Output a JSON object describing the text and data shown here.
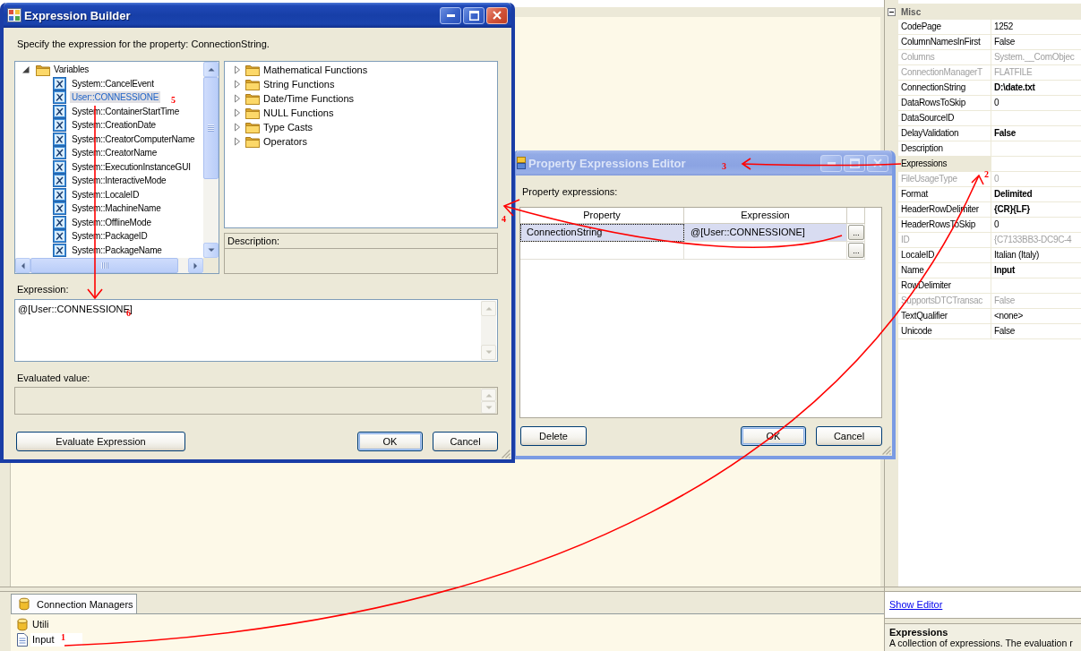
{
  "expression_builder": {
    "title": "Expression Builder",
    "active": true,
    "instruction": "Specify the expression for the property: ConnectionString.",
    "variables": {
      "label": "Variables",
      "expanded": true,
      "selected": false,
      "children": [
        {
          "label": "System::CancelEvent",
          "selected": false
        },
        {
          "label": "User::CONNESSIONE",
          "selected": true
        },
        {
          "label": "System::ContainerStartTime",
          "selected": false
        },
        {
          "label": "System::CreationDate",
          "selected": false
        },
        {
          "label": "System::CreatorComputerName",
          "selected": false
        },
        {
          "label": "System::CreatorName",
          "selected": false
        },
        {
          "label": "System::ExecutionInstanceGUI",
          "selected": false
        },
        {
          "label": "System::InteractiveMode",
          "selected": false
        },
        {
          "label": "System::LocaleID",
          "selected": false
        },
        {
          "label": "System::MachineName",
          "selected": false
        },
        {
          "label": "System::OfflineMode",
          "selected": false
        },
        {
          "label": "System::PackageID",
          "selected": false
        },
        {
          "label": "System::PackageName",
          "selected": false
        }
      ]
    },
    "functions": [
      {
        "label": "Mathematical Functions",
        "expanded": false,
        "selected": false
      },
      {
        "label": "String Functions",
        "expanded": false,
        "selected": false
      },
      {
        "label": "Date/Time Functions",
        "expanded": false,
        "selected": false
      },
      {
        "label": "NULL Functions",
        "expanded": false,
        "selected": false
      },
      {
        "label": "Type Casts",
        "expanded": false,
        "selected": false
      },
      {
        "label": "Operators",
        "expanded": false,
        "selected": false
      }
    ],
    "description_label": "Description:",
    "expression_label": "Expression:",
    "expression": "@[User::CONNESSIONE]",
    "evaluated_label": "Evaluated value:",
    "buttons": [
      {
        "label": "Evaluate Expression",
        "default": false
      },
      {
        "label": "OK",
        "default": true
      },
      {
        "label": "Cancel",
        "default": false
      }
    ]
  },
  "property_expressions_editor": {
    "title": "Property Expressions Editor",
    "active": false,
    "label": "Property expressions:",
    "columns": [
      "Property",
      "Expression"
    ],
    "rows": [
      {
        "property": "ConnectionString",
        "expression": "@[User::CONNESSIONE]",
        "button": "...",
        "selected": true
      },
      {
        "button": "...",
        "selected": false
      }
    ],
    "buttons": [
      {
        "label": "Delete",
        "default": false
      },
      {
        "label": "OK",
        "default": true
      },
      {
        "label": "Cancel",
        "default": false
      }
    ]
  },
  "properties": {
    "category": "Misc",
    "expanded": true,
    "rows": [
      {
        "name": "CodePage",
        "value": {
          "text": "1252",
          "modified": false
        },
        "disabled": false,
        "selected": false
      },
      {
        "name": "ColumnNamesInFirst",
        "value": {
          "text": "False",
          "modified": false
        },
        "disabled": false,
        "selected": false
      },
      {
        "name": "Columns",
        "value": {
          "text": "System.__ComObjec",
          "modified": false
        },
        "disabled": true,
        "selected": false
      },
      {
        "name": "ConnectionManagerT",
        "value": {
          "text": "FLATFILE",
          "modified": false
        },
        "disabled": true,
        "selected": false
      },
      {
        "name": "ConnectionString",
        "value": {
          "text": "D:\\date.txt",
          "modified": true
        },
        "disabled": false,
        "selected": false
      },
      {
        "name": "DataRowsToSkip",
        "value": {
          "text": "0",
          "modified": false
        },
        "disabled": false,
        "selected": false
      },
      {
        "name": "DataSourceID",
        "disabled": false,
        "selected": false
      },
      {
        "name": "DelayValidation",
        "value": {
          "text": "False",
          "modified": true
        },
        "disabled": false,
        "selected": false
      },
      {
        "name": "Description",
        "disabled": false,
        "selected": false
      },
      {
        "name": "Expressions",
        "disabled": false,
        "selected": true
      },
      {
        "name": "FileUsageType",
        "value": {
          "text": "0",
          "modified": false
        },
        "disabled": true,
        "selected": false
      },
      {
        "name": "Format",
        "value": {
          "text": "Delimited",
          "modified": true
        },
        "disabled": false,
        "selected": false
      },
      {
        "name": "HeaderRowDelimiter",
        "value": {
          "text": "{CR}{LF}",
          "modified": true
        },
        "disabled": false,
        "selected": false
      },
      {
        "name": "HeaderRowsToSkip",
        "value": {
          "text": "0",
          "modified": false
        },
        "disabled": false,
        "selected": false
      },
      {
        "name": "ID",
        "value": {
          "text": "{C7133BB3-DC9C-4",
          "modified": false
        },
        "disabled": true,
        "selected": false
      },
      {
        "name": "LocaleID",
        "value": {
          "text": "Italian (Italy)",
          "modified": false
        },
        "disabled": false,
        "selected": false
      },
      {
        "name": "Name",
        "value": {
          "text": "Input",
          "modified": true
        },
        "disabled": false,
        "selected": false
      },
      {
        "name": "RowDelimiter",
        "disabled": false,
        "selected": false
      },
      {
        "name": "SupportsDTCTransac",
        "value": {
          "text": "False",
          "modified": false
        },
        "disabled": true,
        "selected": false
      },
      {
        "name": "TextQualifier",
        "value": {
          "text": "<none>",
          "modified": false
        },
        "disabled": false,
        "selected": false
      },
      {
        "name": "Unicode",
        "value": {
          "text": "False",
          "modified": false
        },
        "disabled": false,
        "selected": false
      }
    ]
  },
  "show_editor": "Show Editor",
  "description": {
    "title": "Expressions",
    "text": "A collection of expressions. The evaluation r"
  },
  "connection_managers": {
    "tab": {
      "label": "Connection Managers",
      "selected": true
    },
    "items": [
      {
        "label": "Utili",
        "kind": "database",
        "selected": false
      },
      {
        "label": "Input",
        "kind": "file",
        "selected": true
      }
    ]
  },
  "annotations": [
    {
      "label": "1"
    },
    {
      "label": "2"
    },
    {
      "label": "3"
    },
    {
      "label": "4"
    },
    {
      "label": "5"
    },
    {
      "label": "6"
    }
  ]
}
